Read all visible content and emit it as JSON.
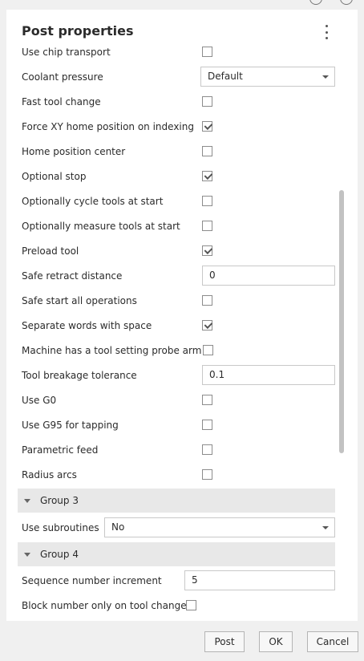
{
  "panel": {
    "title": "Post properties"
  },
  "properties": [
    {
      "label": "Use chip transport",
      "type": "checkbox",
      "checked": false
    },
    {
      "label": "Coolant pressure",
      "type": "select",
      "value": "Default"
    },
    {
      "label": "Fast tool change",
      "type": "checkbox",
      "checked": false
    },
    {
      "label": "Force XY home position on indexing",
      "type": "checkbox",
      "checked": true
    },
    {
      "label": "Home position center",
      "type": "checkbox",
      "checked": false
    },
    {
      "label": "Optional stop",
      "type": "checkbox",
      "checked": true
    },
    {
      "label": "Optionally cycle tools at start",
      "type": "checkbox",
      "checked": false
    },
    {
      "label": "Optionally measure tools at start",
      "type": "checkbox",
      "checked": false
    },
    {
      "label": "Preload tool",
      "type": "checkbox",
      "checked": true
    },
    {
      "label": "Safe retract distance",
      "type": "text",
      "value": "0"
    },
    {
      "label": "Safe start all operations",
      "type": "checkbox",
      "checked": false
    },
    {
      "label": "Separate words with space",
      "type": "checkbox",
      "checked": true
    },
    {
      "label": "Machine has a tool setting probe arm",
      "type": "checkbox",
      "checked": false
    },
    {
      "label": "Tool breakage tolerance",
      "type": "text",
      "value": "0.1"
    },
    {
      "label": "Use G0",
      "type": "checkbox",
      "checked": false
    },
    {
      "label": "Use G95 for tapping",
      "type": "checkbox",
      "checked": false
    },
    {
      "label": "Parametric feed",
      "type": "checkbox",
      "checked": false
    },
    {
      "label": "Radius arcs",
      "type": "checkbox",
      "checked": false
    }
  ],
  "group3": {
    "label": "Group 3",
    "use_subroutines": {
      "label": "Use subroutines",
      "value": "No"
    }
  },
  "group4": {
    "label": "Group 4",
    "sequence_number_increment": {
      "label": "Sequence number increment",
      "value": "5"
    },
    "block_number_only": {
      "label": "Block number only on tool change",
      "checked": false
    }
  },
  "footer": {
    "post_label": "Post",
    "ok_label": "OK",
    "cancel_label": "Cancel"
  },
  "colors": {
    "panel_bg": "#ffffff",
    "window_bg": "#f0f0f0",
    "group_bg": "#e8e8e8"
  }
}
